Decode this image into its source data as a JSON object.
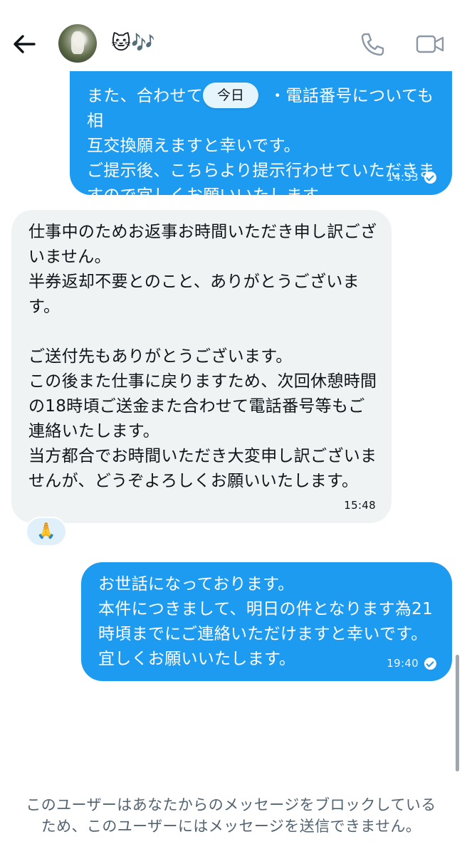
{
  "header": {
    "back_icon": "arrow-left-icon",
    "contact_name": "🐱🎶",
    "call_icon": "phone-icon",
    "video_icon": "video-camera-icon"
  },
  "date_divider": "今日",
  "messages": [
    {
      "direction": "outgoing",
      "text": "また、合わせて　　　　・電話番号についても相\n互交換願えますと幸いです。\nご提示後、こちらより提示行わせていただきま\nすので宜しくお願いいたします。",
      "time": "14:33",
      "status_icon": "read-check-icon"
    },
    {
      "direction": "incoming",
      "text": "仕事中のためお返事お時間いただき申し訳ござ\nいません。\n半券返却不要とのこと、ありがとうございま\nす。\n\nご送付先もありがとうございます。\nこの後また仕事に戻りますため、次回休憩時間\nの18時頃ご送金また合わせて電話番号等もご\n連絡いたします。\n当方都合でお時間いただき大変申し訳ございま\nせんが、どうぞよろしくお願いいたします。",
      "time": "15:48",
      "reaction": "🙏"
    },
    {
      "direction": "outgoing",
      "text": "お世話になっております。\n本件につきまして、明日の件となります為21\n時頃までにご連絡いただけますと幸いです。\n宜しくお願いいたします。",
      "time": "19:40",
      "status_icon": "read-check-icon"
    }
  ],
  "footer_notice": "このユーザーはあなたからのメッセージをブロックしている\nため、このユーザーにはメッセージを送信できません。",
  "colors": {
    "outgoing_bubble": "#1d9bf0",
    "incoming_bubble": "#eff3f4",
    "notice_text": "#536471"
  }
}
